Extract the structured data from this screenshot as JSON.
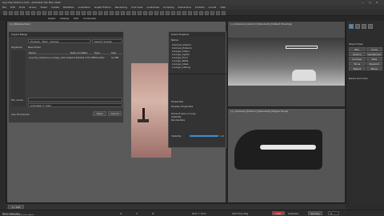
{
  "app": {
    "title": "Any City Interiors.max - Autodesk 3ds Max 2020",
    "window_controls": [
      "—",
      "□",
      "✕"
    ]
  },
  "menu": [
    "File",
    "Edit",
    "Tools",
    "Group",
    "Views",
    "Create",
    "Modifiers",
    "Animation",
    "Graph Editors",
    "Rendering",
    "Civil View",
    "Customize",
    "Scripting",
    "Interactive",
    "Content",
    "Arnold",
    "Help"
  ],
  "tabs": [
    "Select",
    "Display",
    "Edit",
    "Customize"
  ],
  "viewports": {
    "top_right_label": "[+] [Camera_Interior] [Standard] [Default Shading]",
    "bottom_right_label": "[+] [Camera_Exterior] [Standard] [Edged Faces]",
    "left_label": "[+] [Perspective]"
  },
  "file_dialog": {
    "title": "Import Merge",
    "breadcrumb": "Projects › MAX › Scenes",
    "search_placeholder": "Search Scenes",
    "columns": [
      "Name",
      "Date modified",
      "Type",
      "Size"
    ],
    "files": [
      {
        "name": "AnyCity_Interiors_Lounge_v02.max",
        "date": "11/13/2019 4:53 PM",
        "type": "3ds Max",
        "size": "12 MB"
      }
    ],
    "left_nav": [
      "Organize",
      "New folder"
    ],
    "filename_label": "File name:",
    "filename_value": "",
    "filter_value": "Autodesk (*.max)",
    "open_button": "Open",
    "cancel_button": "Cancel",
    "option_label": "Use Thumbnail"
  },
  "scene_explorer": {
    "title": "Scene Explorer",
    "tab_label": "Name",
    "items": [
      "Camera_Interior",
      "Camera_Exterior",
      "Lounge_Chairs",
      "Lounge_Lights",
      "Lounge_Floor",
      "Lounge_Walls",
      "Lounge_Glass",
      "Lounge_Ceiling"
    ]
  },
  "properties": {
    "title": "Properties",
    "subtitle": "Display Properties",
    "rows": [
      "Show Frozen in Gray",
      "Visibility",
      "Renderable"
    ],
    "slider_label": "Visibility",
    "slider_value": "1.0"
  },
  "command_panel": {
    "title": "Object Type",
    "buttons": [
      "Box",
      "Cone",
      "Sphere",
      "GeoSphere",
      "Cylinder",
      "Tube",
      "Torus",
      "Pyramid",
      "Teapot",
      "Plane"
    ],
    "section2": "Name and Color"
  },
  "statusbar": {
    "left": "None Selected",
    "hint": "Click or click-and-drag to select objects",
    "coords": {
      "x": "X:",
      "y": "Y:",
      "z": "Z:"
    },
    "grid": "Grid = 10.0",
    "add_time_tag": "Add Time Tag",
    "auto": "Auto",
    "set_key": "Set Key",
    "selected": "Selected",
    "frame": "0"
  },
  "timeline": {
    "range": "0 / 100"
  },
  "colors": {
    "accent_blue": "#3a8fd8",
    "viewport_gray": "#595959",
    "panel": "#2d2d2d",
    "render_pink": "#c9a69a"
  }
}
